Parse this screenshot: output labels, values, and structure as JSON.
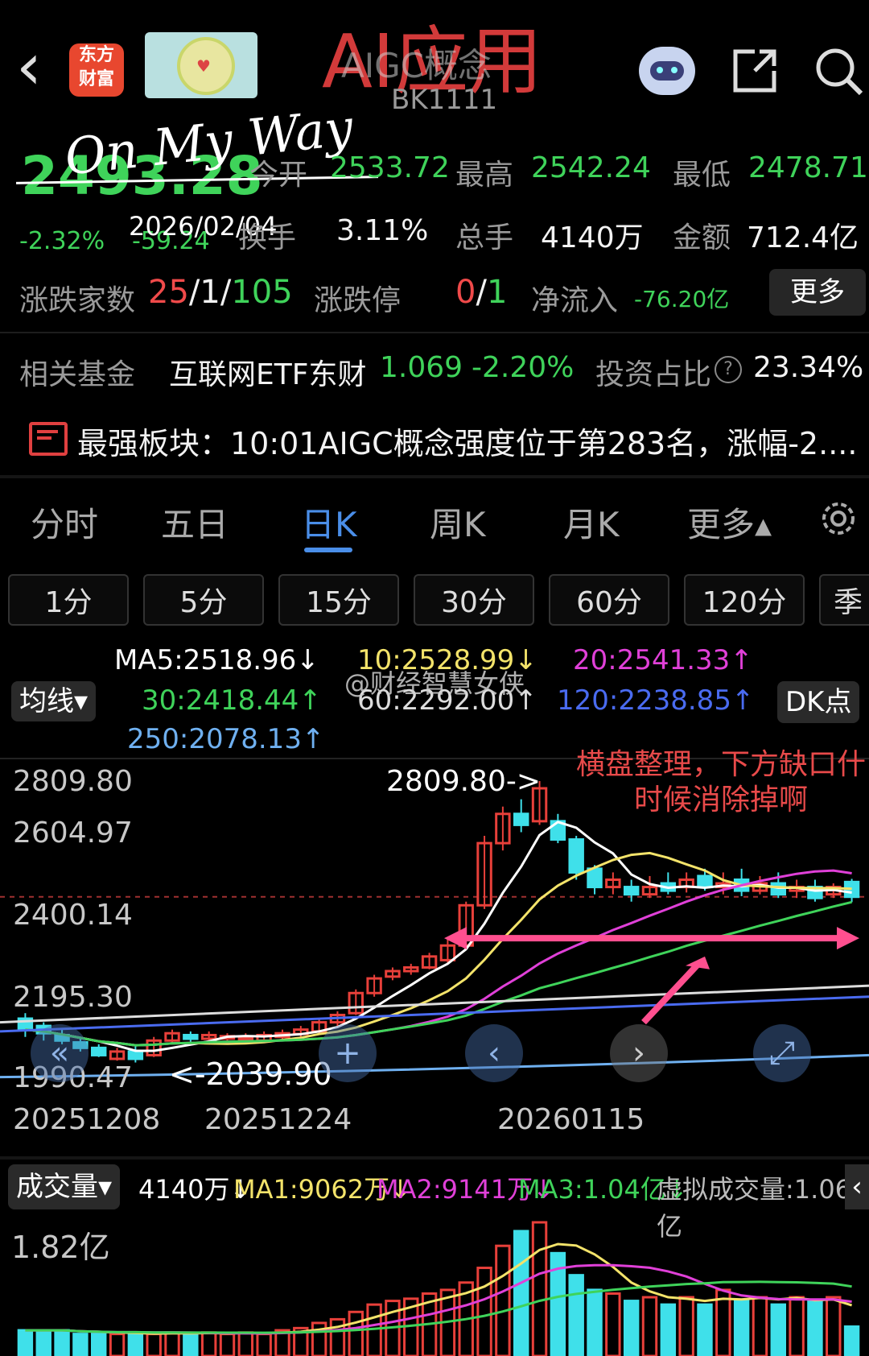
{
  "overlay": {
    "title": "AI应用",
    "signature": "On My Way",
    "date": "2026/02/04"
  },
  "header": {
    "back": "‹",
    "logo": "东方\n财富",
    "name": "AIGC概念",
    "code": "BK1111"
  },
  "quote": {
    "price": "2493.28",
    "change_pct": "-2.32%",
    "change": "-59.24",
    "open_label": "今开",
    "open": "2533.72",
    "high_label": "最高",
    "high": "2542.24",
    "low_label": "最低",
    "low": "2478.71",
    "turnover_label": "换手",
    "turnover": "3.11%",
    "volume_label": "总手",
    "volume": "4140万",
    "amount_label": "金额",
    "amount": "712.4亿",
    "breadth_label": "涨跌家数",
    "up": "25",
    "flat": "1",
    "down": "105",
    "limit_label": "涨跌停",
    "limit_up": "0",
    "limit_down": "1",
    "netflow_label": "净流入",
    "netflow": "-76.20亿",
    "more": "更多"
  },
  "fund": {
    "label": "相关基金",
    "name": "互联网ETF东财",
    "price": "1.069",
    "pct": "-2.20%",
    "ratio_label": "投资占比",
    "ratio": "23.34%"
  },
  "news": {
    "text": "最强板块：10:01AIGC概念强度位于第283名，涨幅-2...."
  },
  "tabs": [
    "分时",
    "五日",
    "日K",
    "周K",
    "月K",
    "更多▴"
  ],
  "intervals": [
    "1分",
    "5分",
    "15分",
    "30分",
    "60分",
    "120分",
    "季"
  ],
  "ma": {
    "selector": "均线▾",
    "ma5": "MA5:2518.96↓",
    "ma10": "10:2528.99↓",
    "ma20": "20:2541.33↑",
    "ma30": "30:2418.44↑",
    "ma60": "60:2292.00↑",
    "ma120": "120:2238.85↑",
    "ma250": "250:2078.13↑",
    "dk": "DK点",
    "watermark": "@财经智慧女侠"
  },
  "chart_data": {
    "type": "candlestick",
    "y_ticks": [
      "2809.80",
      "2604.97",
      "2400.14",
      "2195.30",
      "1990.47"
    ],
    "ylim": [
      1990.47,
      2809.8
    ],
    "x_ticks": [
      "20251208",
      "20251224",
      "20260115"
    ],
    "high_label": "2809.80->",
    "low_label": "<-2039.90",
    "annotation": "横盘整理，下方缺口什\n时候消除掉啊",
    "candles": [
      {
        "o": 2160,
        "c": 2130,
        "h": 2175,
        "l": 2110
      },
      {
        "o": 2140,
        "c": 2120,
        "h": 2150,
        "l": 2100
      },
      {
        "o": 2115,
        "c": 2100,
        "h": 2130,
        "l": 2090
      },
      {
        "o": 2095,
        "c": 2080,
        "h": 2105,
        "l": 2070
      },
      {
        "o": 2080,
        "c": 2060,
        "h": 2090,
        "l": 2055
      },
      {
        "o": 2050,
        "c": 2070,
        "h": 2080,
        "l": 2045
      },
      {
        "o": 2070,
        "c": 2050,
        "h": 2085,
        "l": 2040
      },
      {
        "o": 2060,
        "c": 2100,
        "h": 2110,
        "l": 2055
      },
      {
        "o": 2100,
        "c": 2120,
        "h": 2130,
        "l": 2090
      },
      {
        "o": 2115,
        "c": 2105,
        "h": 2125,
        "l": 2095
      },
      {
        "o": 2105,
        "c": 2115,
        "h": 2125,
        "l": 2100
      },
      {
        "o": 2110,
        "c": 2112,
        "h": 2120,
        "l": 2100
      },
      {
        "o": 2105,
        "c": 2110,
        "h": 2120,
        "l": 2098
      },
      {
        "o": 2100,
        "c": 2115,
        "h": 2125,
        "l": 2095
      },
      {
        "o": 2110,
        "c": 2120,
        "h": 2130,
        "l": 2105
      },
      {
        "o": 2118,
        "c": 2130,
        "h": 2140,
        "l": 2110
      },
      {
        "o": 2125,
        "c": 2150,
        "h": 2160,
        "l": 2120
      },
      {
        "o": 2150,
        "c": 2170,
        "h": 2180,
        "l": 2140
      },
      {
        "o": 2175,
        "c": 2230,
        "h": 2240,
        "l": 2170
      },
      {
        "o": 2230,
        "c": 2270,
        "h": 2280,
        "l": 2220
      },
      {
        "o": 2275,
        "c": 2290,
        "h": 2300,
        "l": 2265
      },
      {
        "o": 2290,
        "c": 2300,
        "h": 2310,
        "l": 2280
      },
      {
        "o": 2300,
        "c": 2330,
        "h": 2340,
        "l": 2295
      },
      {
        "o": 2320,
        "c": 2360,
        "h": 2380,
        "l": 2310
      },
      {
        "o": 2360,
        "c": 2470,
        "h": 2480,
        "l": 2350
      },
      {
        "o": 2470,
        "c": 2640,
        "h": 2660,
        "l": 2460
      },
      {
        "o": 2640,
        "c": 2720,
        "h": 2740,
        "l": 2620
      },
      {
        "o": 2720,
        "c": 2690,
        "h": 2760,
        "l": 2670
      },
      {
        "o": 2700,
        "c": 2790,
        "h": 2809.8,
        "l": 2690
      },
      {
        "o": 2700,
        "c": 2650,
        "h": 2720,
        "l": 2640
      },
      {
        "o": 2650,
        "c": 2560,
        "h": 2660,
        "l": 2540
      },
      {
        "o": 2570,
        "c": 2520,
        "h": 2580,
        "l": 2500
      },
      {
        "o": 2520,
        "c": 2540,
        "h": 2560,
        "l": 2500
      },
      {
        "o": 2520,
        "c": 2500,
        "h": 2540,
        "l": 2480
      },
      {
        "o": 2500,
        "c": 2520,
        "h": 2550,
        "l": 2490
      },
      {
        "o": 2530,
        "c": 2510,
        "h": 2560,
        "l": 2500
      },
      {
        "o": 2520,
        "c": 2540,
        "h": 2560,
        "l": 2505
      },
      {
        "o": 2550,
        "c": 2520,
        "h": 2570,
        "l": 2510
      },
      {
        "o": 2520,
        "c": 2530,
        "h": 2560,
        "l": 2500
      },
      {
        "o": 2540,
        "c": 2510,
        "h": 2570,
        "l": 2495
      },
      {
        "o": 2510,
        "c": 2530,
        "h": 2550,
        "l": 2500
      },
      {
        "o": 2530,
        "c": 2500,
        "h": 2560,
        "l": 2490
      },
      {
        "o": 2510,
        "c": 2520,
        "h": 2540,
        "l": 2490
      },
      {
        "o": 2520,
        "c": 2490,
        "h": 2540,
        "l": 2480
      },
      {
        "o": 2500,
        "c": 2520,
        "h": 2530,
        "l": 2490
      },
      {
        "o": 2533.72,
        "c": 2493.28,
        "h": 2542.24,
        "l": 2478.71
      }
    ],
    "volume": {
      "label": "成交量▾",
      "current": "4140万↓",
      "ma1": "MA1:9062万↓",
      "ma2": "MA2:9141万↓",
      "ma3": "MA3:1.04亿↓",
      "virtual": "虚拟成交量:1.06亿",
      "y_max_label": "1.82亿",
      "values": [
        0.35,
        0.35,
        0.35,
        0.3,
        0.3,
        0.3,
        0.32,
        0.3,
        0.32,
        0.3,
        0.32,
        0.3,
        0.32,
        0.3,
        0.35,
        0.38,
        0.45,
        0.5,
        0.6,
        0.7,
        0.75,
        0.78,
        0.85,
        0.9,
        1.0,
        1.2,
        1.5,
        1.7,
        1.82,
        1.4,
        1.1,
        0.9,
        0.85,
        0.75,
        0.8,
        0.7,
        0.8,
        0.7,
        0.9,
        0.75,
        0.8,
        0.7,
        0.8,
        0.75,
        0.8,
        0.4
      ]
    }
  }
}
